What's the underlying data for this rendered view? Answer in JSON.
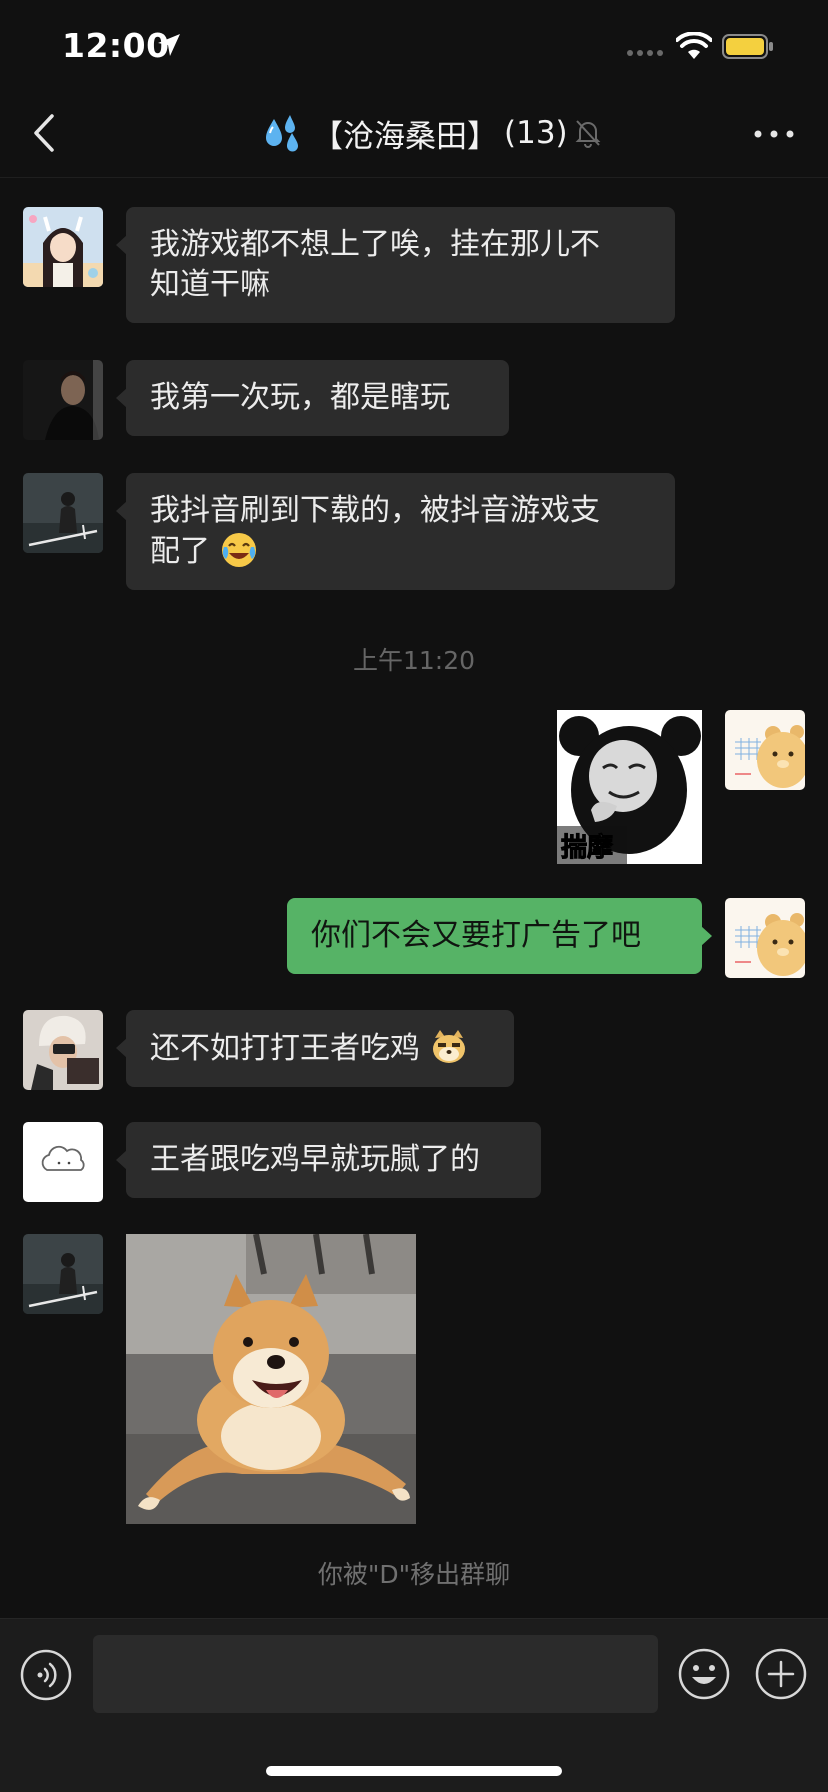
{
  "status_bar": {
    "time": "12:00"
  },
  "nav": {
    "back_label": "‹",
    "title": "【沧海桑田】",
    "member_count": "(13)",
    "more_label": "•••"
  },
  "messages": [
    {
      "side": "left",
      "type": "text",
      "lines": [
        "我游戏都不想上了唉，挂在那儿不",
        "知道干嘛"
      ]
    },
    {
      "side": "left",
      "type": "text",
      "lines": [
        "我第一次玩，都是瞎玩"
      ]
    },
    {
      "side": "left",
      "type": "text",
      "lines": [
        "我抖音刷到下载的，被抖音游戏支",
        "配了"
      ],
      "trailing_emoji": "laughing-crying-emoji"
    },
    {
      "type": "timestamp",
      "text": "上午11:20"
    },
    {
      "side": "right",
      "type": "sticker",
      "caption": "揣摩",
      "sticker": "panda-meme-sticker"
    },
    {
      "side": "right",
      "type": "text",
      "lines": [
        "你们不会又要打广告了吧"
      ]
    },
    {
      "side": "left",
      "type": "text",
      "lines": [
        "还不如打打王者吃鸡"
      ],
      "trailing_emoji": "doge-emoji"
    },
    {
      "side": "left",
      "type": "text",
      "lines": [
        "王者跟吃鸡早就玩腻了的"
      ]
    },
    {
      "side": "left",
      "type": "sticker",
      "sticker": "shiba-dog-sticker"
    },
    {
      "type": "system",
      "text": "你被\"D\"移出群聊"
    }
  ],
  "input_bar": {
    "placeholder": ""
  },
  "colors": {
    "background": "#111111",
    "bubble_in": "#2c2c2c",
    "bubble_out": "#56b366",
    "muted_text": "#666666"
  }
}
